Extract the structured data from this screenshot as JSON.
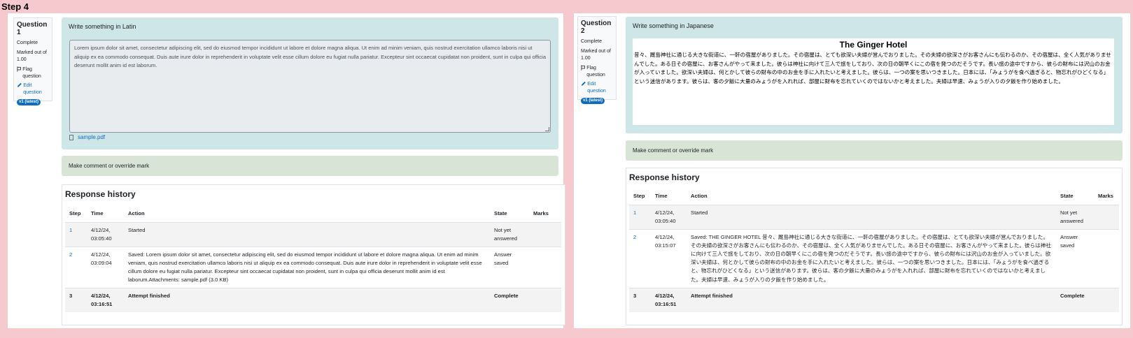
{
  "step_title": "Step 4",
  "panels": [
    {
      "question_label": "Question",
      "question_number": "1",
      "status": "Complete",
      "marked": "Marked out of 1.00",
      "flag": "Flag question",
      "edit": "Edit question",
      "badge": "v1 (latest)",
      "prompt": "Write something in Latin",
      "answer": "Lorem ipsum dolor sit amet, consectetur adipiscing elit, sed do eiusmod tempor incididunt ut labore et dolore magna aliqua. Ut enim ad minim veniam, quis nostrud exercitation ullamco laboris nisi ut aliquip ex ea commodo consequat. Duis aute irure dolor in reprehenderit in voluptate velit esse cillum dolore eu fugiat nulla pariatur. Excepteur sint occaecat cupidatat non proident, sunt in culpa qui officia deserunt mollit anim id est laborum.",
      "attachment": "sample.pdf",
      "comment": "Make comment or override mark",
      "history_title": "Response history",
      "headers": [
        "Step",
        "Time",
        "Action",
        "State",
        "Marks"
      ],
      "rows": [
        {
          "step": "1",
          "time": "4/12/24, 03:05:40",
          "action": "Started",
          "state": "Not yet answered",
          "marks": ""
        },
        {
          "step": "2",
          "time": "4/12/24, 03:09:04",
          "action": "Saved: Lorem ipsum dolor sit amet, consectetur adipiscing elit, sed do eiusmod tempor incididunt ut labore et dolore magna aliqua. Ut enim ad minim veniam, quis nostrud exercitation ullamco laboris nisi ut aliquip ex ea commodo consequat. Duis aute irure dolor in reprehenderit in voluptate velit esse cillum dolore eu fugiat nulla pariatur. Excepteur sint occaecat cupidatat non proident, sunt in culpa qui officia deserunt mollit anim id est laborum.Attachments: sample.pdf (3.0 KB)",
          "state": "Answer saved",
          "marks": ""
        },
        {
          "step": "3",
          "time": "4/12/24, 03:16:51",
          "action": "Attempt finished",
          "state": "Complete",
          "marks": ""
        }
      ]
    },
    {
      "question_label": "Question",
      "question_number": "2",
      "status": "Complete",
      "marked": "Marked out of 1.00",
      "flag": "Flag question",
      "edit": "Edit question",
      "badge": "v1 (latest)",
      "prompt": "Write something in Japanese",
      "answer_title": "The Ginger Hotel",
      "answer": "昔々、厩島神社に通じる大きな街道に、一軒の宿屋がありました。その宿屋は、とても欲深い夫婦が営んでおりました。その夫婦の欲深さがお客さんにも伝わるのか、その宿屋は、全く人気がありませんでした。ある日その宿屋に、お客さんがやって来ました。彼らは神社に向けて三人で旅をしており、次の日の朝早くにこの宿を発つのだそうです。長い旅の途中ですから、彼らの財布には沢山のお金が入っていました。欲深い夫婦は、何とかして彼らの財布の中のお金を手に入れたいと考えました。彼らは、一つの案を思いつきました。日本には、「みょうがを食べ過ぎると、物忘れがひどくなる」という迷信があります。彼らは、客の夕飯に大量のみょうがを入れれば、部屋に財布を忘れていくのではないかと考えました。夫婦は早速、みょうが入りの夕飯を作り始めました。",
      "comment": "Make comment or override mark",
      "history_title": "Response history",
      "headers": [
        "Step",
        "Time",
        "Action",
        "State",
        "Marks"
      ],
      "rows": [
        {
          "step": "1",
          "time": "4/12/24, 03:05:40",
          "action": "Started",
          "state": "Not yet answered",
          "marks": ""
        },
        {
          "step": "2",
          "time": "4/12/24, 03:15:07",
          "action": "Saved: THE GINGER HOTEL 昔々、厩島神社に通じる大きな街道に、一軒の宿屋がありました。その宿屋は、とても欲深い夫婦が営んでおりました。その夫婦の欲深さがお客さんにも伝わるのか、その宿屋は、全く人気がありませんでした。ある日その宿屋に、お客さんがやって来ました。彼らは神社に向けて三人で旅をしており、次の日の朝早くにこの宿を発つのだそうです。長い旅の途中ですから、彼らの財布には沢山のお金が入っていました。欲深い夫婦は、何とかして彼らの財布の中のお金を手に入れたいと考えました。彼らは、一つの案を思いつきました。日本には、「みょうがを食べ過ぎると、物忘れがひどくなる」という迷信があります。彼らは、客の夕飯に大量のみょうがを入れれば、部屋に財布を忘れていくのではないかと考えました。夫婦は早速、みょうが入りの夕飯を作り始めました。",
          "state": "Answer saved",
          "marks": ""
        },
        {
          "step": "3",
          "time": "4/12/24, 03:16:51",
          "action": "Attempt finished",
          "state": "Complete",
          "marks": ""
        }
      ]
    }
  ]
}
